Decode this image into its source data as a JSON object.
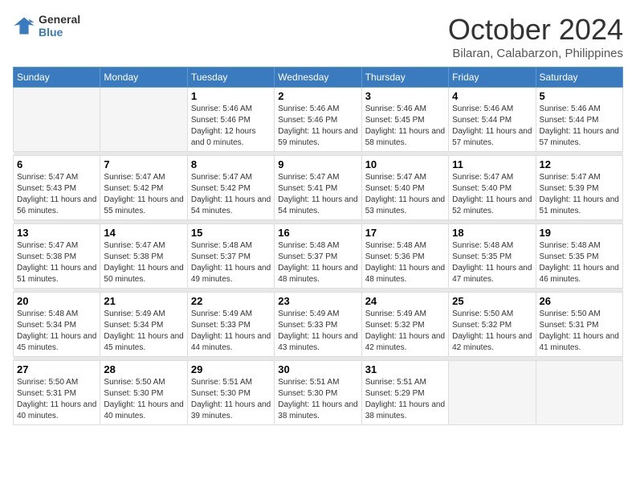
{
  "logo": {
    "line1": "General",
    "line2": "Blue"
  },
  "title": "October 2024",
  "location": "Bilaran, Calabarzon, Philippines",
  "weekdays": [
    "Sunday",
    "Monday",
    "Tuesday",
    "Wednesday",
    "Thursday",
    "Friday",
    "Saturday"
  ],
  "days": [
    {
      "num": "",
      "info": ""
    },
    {
      "num": "",
      "info": ""
    },
    {
      "num": "1",
      "sunrise": "5:46 AM",
      "sunset": "5:46 PM",
      "daylight": "12 hours and 0 minutes."
    },
    {
      "num": "2",
      "sunrise": "5:46 AM",
      "sunset": "5:46 PM",
      "daylight": "11 hours and 59 minutes."
    },
    {
      "num": "3",
      "sunrise": "5:46 AM",
      "sunset": "5:45 PM",
      "daylight": "11 hours and 58 minutes."
    },
    {
      "num": "4",
      "sunrise": "5:46 AM",
      "sunset": "5:44 PM",
      "daylight": "11 hours and 57 minutes."
    },
    {
      "num": "5",
      "sunrise": "5:46 AM",
      "sunset": "5:44 PM",
      "daylight": "11 hours and 57 minutes."
    },
    {
      "num": "6",
      "sunrise": "5:47 AM",
      "sunset": "5:43 PM",
      "daylight": "11 hours and 56 minutes."
    },
    {
      "num": "7",
      "sunrise": "5:47 AM",
      "sunset": "5:42 PM",
      "daylight": "11 hours and 55 minutes."
    },
    {
      "num": "8",
      "sunrise": "5:47 AM",
      "sunset": "5:42 PM",
      "daylight": "11 hours and 54 minutes."
    },
    {
      "num": "9",
      "sunrise": "5:47 AM",
      "sunset": "5:41 PM",
      "daylight": "11 hours and 54 minutes."
    },
    {
      "num": "10",
      "sunrise": "5:47 AM",
      "sunset": "5:40 PM",
      "daylight": "11 hours and 53 minutes."
    },
    {
      "num": "11",
      "sunrise": "5:47 AM",
      "sunset": "5:40 PM",
      "daylight": "11 hours and 52 minutes."
    },
    {
      "num": "12",
      "sunrise": "5:47 AM",
      "sunset": "5:39 PM",
      "daylight": "11 hours and 51 minutes."
    },
    {
      "num": "13",
      "sunrise": "5:47 AM",
      "sunset": "5:38 PM",
      "daylight": "11 hours and 51 minutes."
    },
    {
      "num": "14",
      "sunrise": "5:47 AM",
      "sunset": "5:38 PM",
      "daylight": "11 hours and 50 minutes."
    },
    {
      "num": "15",
      "sunrise": "5:48 AM",
      "sunset": "5:37 PM",
      "daylight": "11 hours and 49 minutes."
    },
    {
      "num": "16",
      "sunrise": "5:48 AM",
      "sunset": "5:37 PM",
      "daylight": "11 hours and 48 minutes."
    },
    {
      "num": "17",
      "sunrise": "5:48 AM",
      "sunset": "5:36 PM",
      "daylight": "11 hours and 48 minutes."
    },
    {
      "num": "18",
      "sunrise": "5:48 AM",
      "sunset": "5:35 PM",
      "daylight": "11 hours and 47 minutes."
    },
    {
      "num": "19",
      "sunrise": "5:48 AM",
      "sunset": "5:35 PM",
      "daylight": "11 hours and 46 minutes."
    },
    {
      "num": "20",
      "sunrise": "5:48 AM",
      "sunset": "5:34 PM",
      "daylight": "11 hours and 45 minutes."
    },
    {
      "num": "21",
      "sunrise": "5:49 AM",
      "sunset": "5:34 PM",
      "daylight": "11 hours and 45 minutes."
    },
    {
      "num": "22",
      "sunrise": "5:49 AM",
      "sunset": "5:33 PM",
      "daylight": "11 hours and 44 minutes."
    },
    {
      "num": "23",
      "sunrise": "5:49 AM",
      "sunset": "5:33 PM",
      "daylight": "11 hours and 43 minutes."
    },
    {
      "num": "24",
      "sunrise": "5:49 AM",
      "sunset": "5:32 PM",
      "daylight": "11 hours and 42 minutes."
    },
    {
      "num": "25",
      "sunrise": "5:50 AM",
      "sunset": "5:32 PM",
      "daylight": "11 hours and 42 minutes."
    },
    {
      "num": "26",
      "sunrise": "5:50 AM",
      "sunset": "5:31 PM",
      "daylight": "11 hours and 41 minutes."
    },
    {
      "num": "27",
      "sunrise": "5:50 AM",
      "sunset": "5:31 PM",
      "daylight": "11 hours and 40 minutes."
    },
    {
      "num": "28",
      "sunrise": "5:50 AM",
      "sunset": "5:30 PM",
      "daylight": "11 hours and 40 minutes."
    },
    {
      "num": "29",
      "sunrise": "5:51 AM",
      "sunset": "5:30 PM",
      "daylight": "11 hours and 39 minutes."
    },
    {
      "num": "30",
      "sunrise": "5:51 AM",
      "sunset": "5:30 PM",
      "daylight": "11 hours and 38 minutes."
    },
    {
      "num": "31",
      "sunrise": "5:51 AM",
      "sunset": "5:29 PM",
      "daylight": "11 hours and 38 minutes."
    }
  ]
}
